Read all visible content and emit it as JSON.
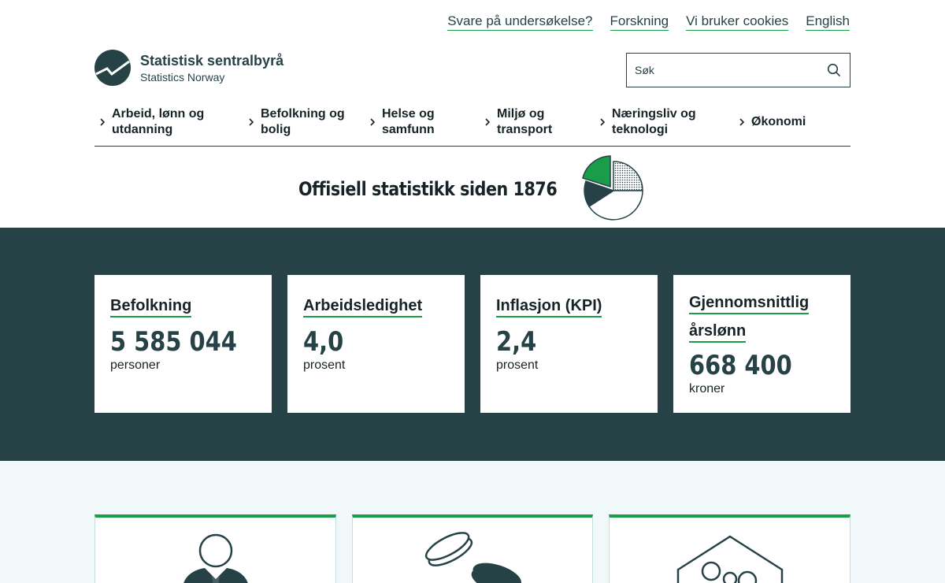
{
  "top_links": [
    "Svare på undersøkelse?",
    "Forskning",
    "Vi bruker cookies",
    "English"
  ],
  "logo": {
    "name": "Statistisk sentralbyrå",
    "subtitle": "Statistics Norway"
  },
  "search": {
    "placeholder": "Søk",
    "icon": "search-icon"
  },
  "nav": [
    {
      "line1": "Arbeid, lønn og",
      "line2": "utdanning"
    },
    {
      "line1": "Befolkning og",
      "line2": "bolig"
    },
    {
      "line1": "Helse og",
      "line2": "samfunn"
    },
    {
      "line1": "Miljø og",
      "line2": "transport"
    },
    {
      "line1": "Næringsliv og",
      "line2": "teknologi"
    },
    {
      "line1": "Økonomi",
      "line2": ""
    }
  ],
  "hero": {
    "title": "Offisiell statistikk siden 1876",
    "icon": "pie-chart-icon"
  },
  "key_figures": [
    {
      "title": "Befolkning",
      "value": "5 585 044",
      "unit": "personer"
    },
    {
      "title": "Arbeidsledighet",
      "value": "4,0",
      "unit": "prosent"
    },
    {
      "title": "Inflasjon (KPI)",
      "value": "2,4",
      "unit": "prosent"
    },
    {
      "title": "Gjennomsnittlig årslønn",
      "value": "668 400",
      "unit": "kroner"
    }
  ],
  "tiles": [
    {
      "icon": "people-icon"
    },
    {
      "icon": "coins-icon"
    },
    {
      "icon": "house-family-icon"
    }
  ],
  "colors": {
    "dark": "#274247",
    "accent": "#1a9d49",
    "light_bg": "#f0f8f9"
  }
}
